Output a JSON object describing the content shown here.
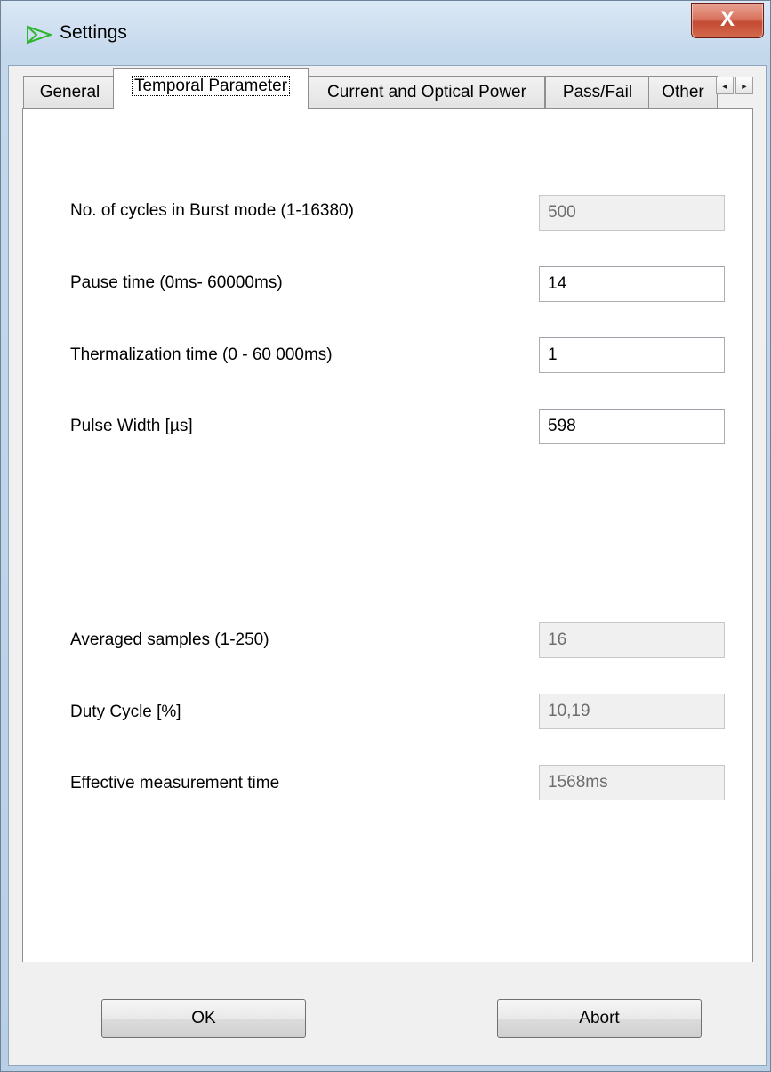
{
  "window": {
    "title": "Settings",
    "close_label": "X"
  },
  "tabs": [
    {
      "label": "General",
      "active": false
    },
    {
      "label": "Temporal Parameter",
      "active": true
    },
    {
      "label": "Current and Optical Power",
      "active": false
    },
    {
      "label": "Pass/Fail",
      "active": false
    },
    {
      "label": "Other",
      "active": false
    }
  ],
  "tab_scroll": {
    "left": "◄",
    "right": "►"
  },
  "fields": {
    "burst_cycles": {
      "label": "No. of cycles in Burst mode (1-16380)",
      "value": "500",
      "enabled": false
    },
    "pause_time": {
      "label": "Pause time (0ms- 60000ms)",
      "value": "14",
      "enabled": true
    },
    "thermalization_time": {
      "label": "Thermalization time (0 - 60 000ms)",
      "value": "1",
      "enabled": true
    },
    "pulse_width": {
      "label": "Pulse Width [µs]",
      "value": "598",
      "enabled": true
    },
    "averaged_samples": {
      "label": "Averaged samples (1-250)",
      "value": "16",
      "enabled": false
    },
    "duty_cycle": {
      "label": "Duty Cycle [%]",
      "value": "10,19",
      "enabled": false
    },
    "effective_time": {
      "label": "Effective measurement time",
      "value": "1568ms",
      "enabled": false
    }
  },
  "buttons": {
    "ok": "OK",
    "abort": "Abort"
  }
}
